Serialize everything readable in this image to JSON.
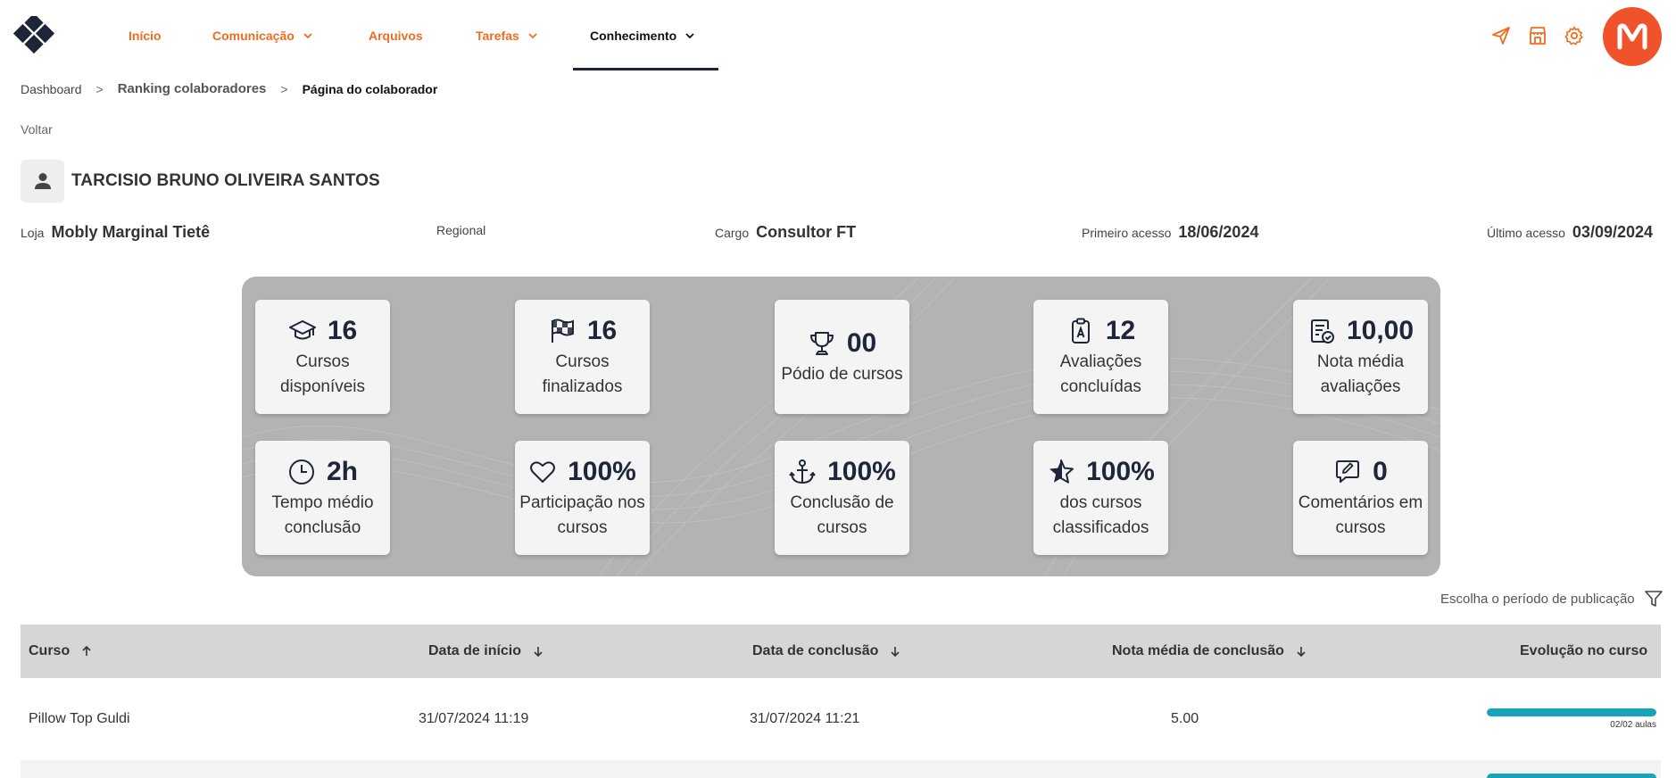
{
  "nav": {
    "items": [
      {
        "label": "Início",
        "dropdown": false
      },
      {
        "label": "Comunicação",
        "dropdown": true
      },
      {
        "label": "Arquivos",
        "dropdown": false
      },
      {
        "label": "Tarefas",
        "dropdown": true
      },
      {
        "label": "Conhecimento",
        "dropdown": true,
        "active": true
      }
    ],
    "avatar_letter": "M",
    "accent_color": "#f26c1f",
    "avatar_color": "#f0532b",
    "icons": [
      "send-icon",
      "store-icon",
      "gear-icon"
    ]
  },
  "breadcrumb": {
    "items": [
      "Dashboard",
      "Ranking colaboradores",
      "Página do colaborador"
    ],
    "separator": ">"
  },
  "back_label": "Voltar",
  "user": {
    "name": "TARCISIO BRUNO OLIVEIRA SANTOS",
    "store_label": "Loja",
    "store_value": "Mobly Marginal Tietê",
    "regional_label": "Regional",
    "regional_value": "",
    "role_label": "Cargo",
    "role_value": "Consultor FT",
    "first_access_label": "Primeiro acesso",
    "first_access_value": "18/06/2024",
    "last_access_label": "Último acesso",
    "last_access_value": "03/09/2024"
  },
  "stats": [
    {
      "icon": "graduation-cap-icon",
      "value": "16",
      "label": "Cursos disponíveis"
    },
    {
      "icon": "checkered-flag-icon",
      "value": "16",
      "label": "Cursos finalizados"
    },
    {
      "icon": "trophy-icon",
      "value": "00",
      "label": "Pódio de cursos"
    },
    {
      "icon": "clipboard-a-icon",
      "value": "12",
      "label": "Avaliações concluídas"
    },
    {
      "icon": "clipboard-check-icon",
      "value": "10,00",
      "label": "Nota média avaliações"
    },
    {
      "icon": "clock-icon",
      "value": "2h",
      "label": "Tempo médio conclusão"
    },
    {
      "icon": "heart-icon",
      "value": "100%",
      "label": "Participação nos cursos"
    },
    {
      "icon": "anchor-icon",
      "value": "100%",
      "label": "Conclusão de cursos"
    },
    {
      "icon": "star-icon",
      "value": "100%",
      "label": "dos cursos classificados"
    },
    {
      "icon": "comment-edit-icon",
      "value": "0",
      "label": "Comentários em cursos"
    }
  ],
  "filter_label": "Escolha o período de publicação",
  "table": {
    "columns": [
      {
        "label": "Curso",
        "sort": "asc"
      },
      {
        "label": "Data de início",
        "sort": "desc"
      },
      {
        "label": "Data de conclusão",
        "sort": "desc"
      },
      {
        "label": "Nota média de conclusão",
        "sort": "desc"
      },
      {
        "label": "Evolução no curso",
        "sort": "none"
      }
    ],
    "rows": [
      {
        "course": "Pillow Top Guldi",
        "start": "31/07/2024 11:19",
        "end": "31/07/2024 11:21",
        "grade": "5.00",
        "progress": 1.0,
        "progress_text": "02/02 aulas"
      }
    ],
    "progress_color": "#17a3b8"
  }
}
